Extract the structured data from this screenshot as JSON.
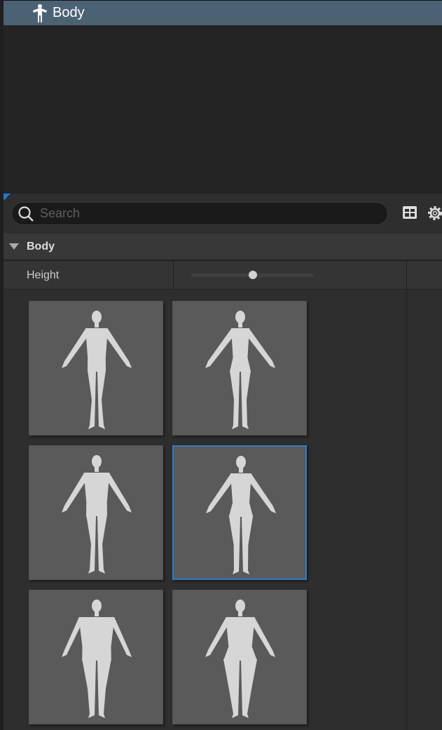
{
  "outliner": {
    "selected_item": {
      "label": "Body",
      "icon": "body-icon"
    }
  },
  "details": {
    "search": {
      "placeholder": "Search",
      "value": ""
    },
    "toolbar": {
      "icons": [
        "table-view-icon",
        "settings-gear-icon"
      ]
    },
    "category": {
      "label": "Body",
      "expanded": true
    },
    "properties": [
      {
        "label": "Height",
        "slider_value": 0.5
      }
    ],
    "presets": [
      {
        "gender": "male",
        "build": "thin",
        "selected": false
      },
      {
        "gender": "female",
        "build": "thin",
        "selected": false
      },
      {
        "gender": "male",
        "build": "athletic",
        "selected": false
      },
      {
        "gender": "female",
        "build": "athletic",
        "selected": true
      },
      {
        "gender": "male",
        "build": "heavy",
        "selected": false
      },
      {
        "gender": "female",
        "build": "heavy",
        "selected": false
      }
    ]
  },
  "colors": {
    "selection": "#4b6275",
    "accent": "#2a7fd0"
  }
}
